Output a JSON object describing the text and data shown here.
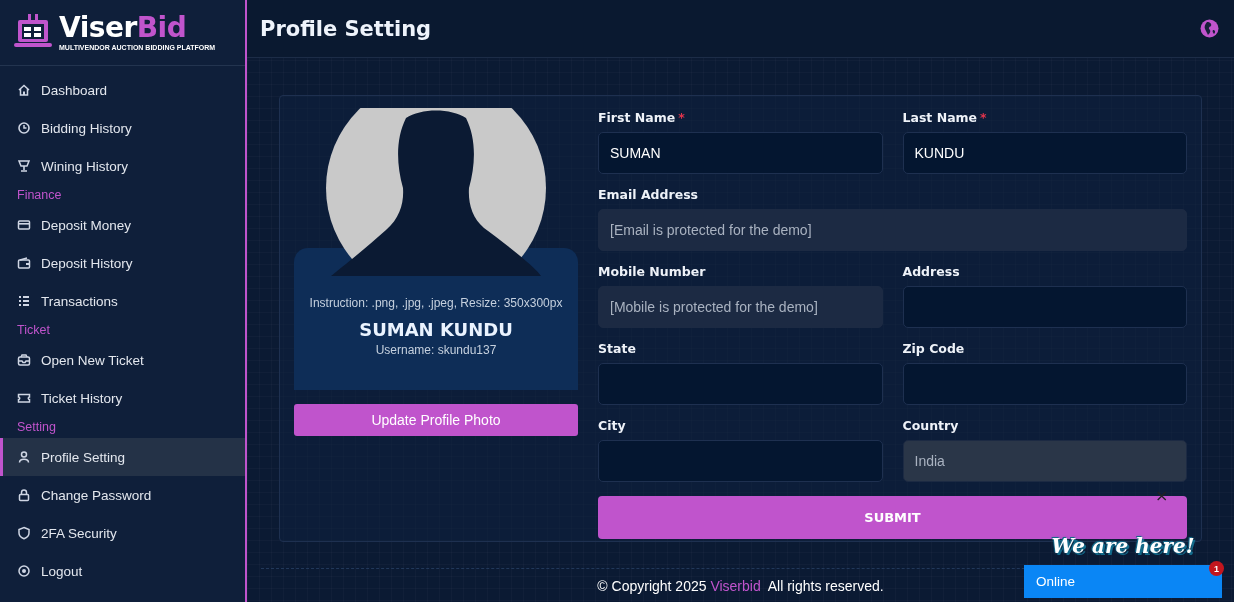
{
  "logo": {
    "name_main": "Viser",
    "name_accent": "Bid",
    "tagline": "MULTIVENDOR AUCTION BIDDING PLATFORM"
  },
  "sidebar": {
    "items": [
      {
        "kind": "link",
        "label": "Dashboard",
        "selected": false
      },
      {
        "kind": "link",
        "label": "Bidding History",
        "selected": false
      },
      {
        "kind": "link",
        "label": "Wining History",
        "selected": false
      },
      {
        "kind": "heading",
        "label": "Finance"
      },
      {
        "kind": "link",
        "label": "Deposit Money",
        "selected": false
      },
      {
        "kind": "link",
        "label": "Deposit History",
        "selected": false
      },
      {
        "kind": "link",
        "label": "Transactions",
        "selected": false
      },
      {
        "kind": "heading",
        "label": "Ticket"
      },
      {
        "kind": "link",
        "label": "Open New Ticket",
        "selected": false
      },
      {
        "kind": "link",
        "label": "Ticket History",
        "selected": false
      },
      {
        "kind": "heading",
        "label": "Setting"
      },
      {
        "kind": "link",
        "label": "Profile Setting",
        "selected": true
      },
      {
        "kind": "link",
        "label": "Change Password",
        "selected": false
      },
      {
        "kind": "link",
        "label": "2FA Security",
        "selected": false
      },
      {
        "kind": "link",
        "label": "Logout",
        "selected": false
      }
    ]
  },
  "header": {
    "title": "Profile Setting"
  },
  "profile": {
    "instruction": "Instruction: .png, .jpg, .jpeg, Resize: 350x300px",
    "name": "SUMAN KUNDU",
    "username": "Username: skundu137",
    "button": "Update Profile Photo"
  },
  "form": {
    "rows": [
      [
        {
          "label": "First Name",
          "required_mark": "*",
          "value": "SUMAN",
          "disabled": false
        },
        {
          "label": "Last Name",
          "required_mark": "*",
          "value": "KUNDU",
          "disabled": false
        }
      ],
      [
        {
          "label": "Email Address",
          "value": "[Email is protected for the demo]",
          "disabled": true
        }
      ],
      [
        {
          "label": "Mobile Number",
          "value": "[Mobile is protected for the demo]",
          "disabled": true
        },
        {
          "label": "Address",
          "disabled": false
        }
      ],
      [
        {
          "label": "State",
          "disabled": false
        },
        {
          "label": "Zip Code",
          "disabled": false
        }
      ],
      [
        {
          "label": "City",
          "disabled": false
        },
        {
          "label": "Country",
          "value": "India",
          "disabled": true
        }
      ]
    ],
    "submit": "SUBMIT"
  },
  "footer": {
    "prefix": "© Copyright 2025",
    "link": "Viserbid",
    "suffix": "All rights reserved."
  },
  "chat": {
    "close": "×",
    "greeting": "We are here!",
    "status": "Online",
    "badge": "1"
  }
}
